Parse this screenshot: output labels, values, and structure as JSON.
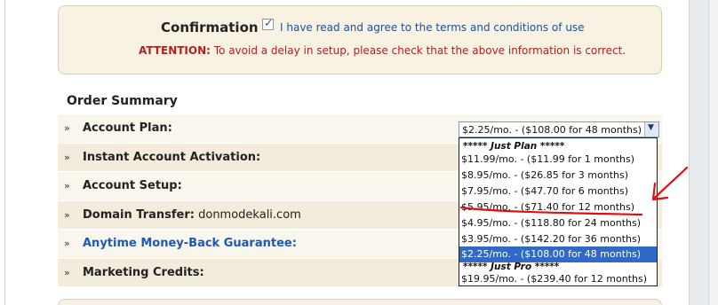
{
  "confirmation": {
    "title": "Confirmation",
    "checkbox_checked": true,
    "agree_text": "I have read and agree to the terms and conditions of use",
    "attention_label": "ATTENTION:",
    "attention_text": " To avoid a delay in setup, please check that the above information is correct."
  },
  "order_summary": {
    "heading": "Order Summary",
    "rows": [
      {
        "bullet": "»",
        "label": "Account Plan:",
        "value": ""
      },
      {
        "bullet": "»",
        "label": "Instant Account Activation:",
        "value": ""
      },
      {
        "bullet": "»",
        "label": "Account Setup:",
        "value": ""
      },
      {
        "bullet": "»",
        "label": "Domain Transfer:",
        "value": " donmodekali.com"
      },
      {
        "bullet": "»",
        "label": "Anytime Money-Back Guarantee:",
        "value": ""
      },
      {
        "bullet": "»",
        "label": "Marketing Credits:",
        "value": ""
      }
    ]
  },
  "plan_select": {
    "selected": "$2.25/mo. - ($108.00 for 48 months)",
    "options": [
      {
        "text": "***** Just Plan *****",
        "type": "group"
      },
      {
        "text": "$11.99/mo. - ($11.99 for 1 months)",
        "type": "option"
      },
      {
        "text": "$8.95/mo. - ($26.85 for 3 months)",
        "type": "option"
      },
      {
        "text": "$7.95/mo. - ($47.70 for 6 months)",
        "type": "option"
      },
      {
        "text": "$5.95/mo. - ($71.40 for 12 months)",
        "type": "option"
      },
      {
        "text": "$4.95/mo. - ($118.80 for 24 months)",
        "type": "option"
      },
      {
        "text": "$3.95/mo. - ($142.20 for 36 months)",
        "type": "option"
      },
      {
        "text": "$2.25/mo. - ($108.00 for 48 months)",
        "type": "option"
      },
      {
        "text": "***** Just Pro *****",
        "type": "group"
      },
      {
        "text": "$19.95/mo. - ($239.40 for 12 months)",
        "type": "option"
      }
    ]
  },
  "colors": {
    "accent_blue": "#1c58b8",
    "attention_red": "#b02020",
    "selection_blue": "#3169c6",
    "annotation_red": "#e01010"
  }
}
